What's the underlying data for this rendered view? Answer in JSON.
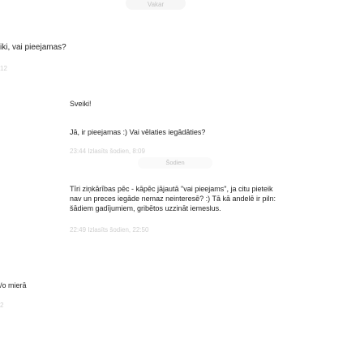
{
  "chat": {
    "day_top": "Vakar",
    "messages": [
      {
        "text": "iki, vai pieejamas?",
        "meta": "12"
      },
      {
        "text": "Sveiki!",
        "meta": ""
      },
      {
        "text": "Jā, ir pieejamas :) Vai vēlaties iegādāties?",
        "meta": "23:44   Izlasīts šodien, 8:09"
      },
      {
        "text_lines": [
          "Tīri ziņkārības pēc - kāpēc jājautā \"vai pieejams\", ja citu pieteik",
          "nav un preces iegāde nemaz neinteresē? :) Tā kā andelē ir piln:",
          "šādiem gadījumiem, gribētos uzzināt iemeslus."
        ],
        "meta": "22:49   Izlasīts šodien, 22:50"
      },
      {
        "text": "/o mierā",
        "meta": "2"
      }
    ],
    "day_divider": "Šodien"
  }
}
